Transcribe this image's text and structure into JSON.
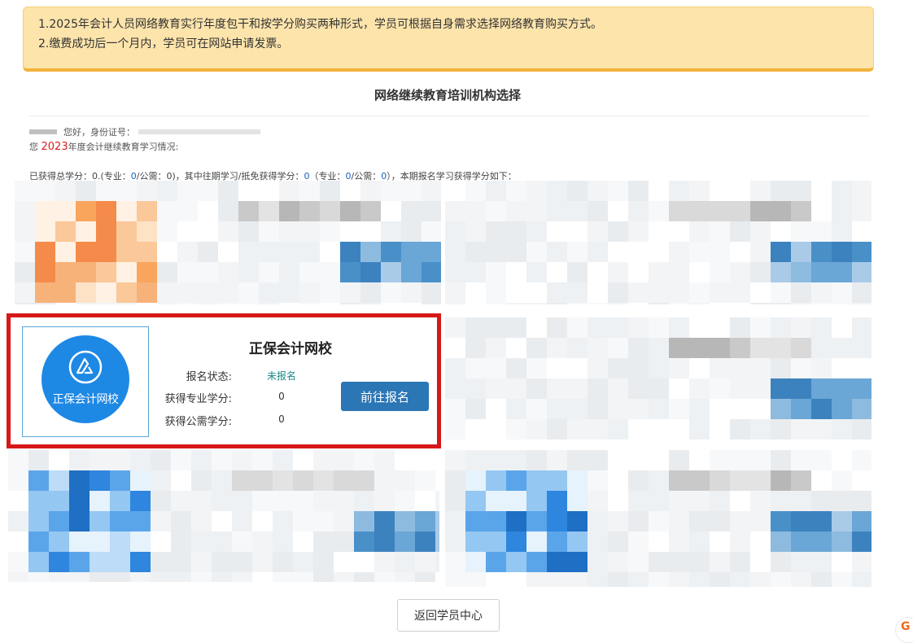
{
  "notice": {
    "line1": "1.2025年会计人员网络教育实行年度包干和按学分购买两种形式，学员可根据自身需求选择网络教育购买方式。",
    "line2": "2.缴费成功后一个月内，学员可在网站申请发票。"
  },
  "page_title": "网络继续教育培训机构选择",
  "user": {
    "greeting": "您好，身份证号：",
    "year_prefix": "您",
    "year": "2023",
    "year_suffix": "年度会计继续教育学习情况:"
  },
  "credits": {
    "p1": "已获得总学分：0.(专业：",
    "v1": "0",
    "p2": "/公需：0)，其中往期学习/抵免获得学分：",
    "v2": "0",
    "p3": "（专业：",
    "v3": "0",
    "p4": "/公需：",
    "v4": "0",
    "p5": "），本期报名学习获得学分如下："
  },
  "highlighted_card": {
    "logo_text": "正保会计网校",
    "org_name": "正保会计网校",
    "status_label": "报名状态:",
    "status_value": "未报名",
    "professional_label": "获得专业学分:",
    "professional_value": "0",
    "public_label": "获得公需学分:",
    "public_value": "0",
    "enroll_button": "前往报名"
  },
  "back_button": "返回学员中心",
  "colors": {
    "notice_bg": "#fde4ab",
    "notice_border": "#f2b33a",
    "highlight_border": "#d71818",
    "enroll_button_bg": "#2b76b5",
    "logo_blue": "#1e88e5",
    "year_red": "#d62020",
    "status_teal": "#1a8a8a"
  },
  "icons": {
    "logo": "school-logo-icon",
    "corner": "chat-widget-icon"
  },
  "corner_widget_glyph": "G"
}
